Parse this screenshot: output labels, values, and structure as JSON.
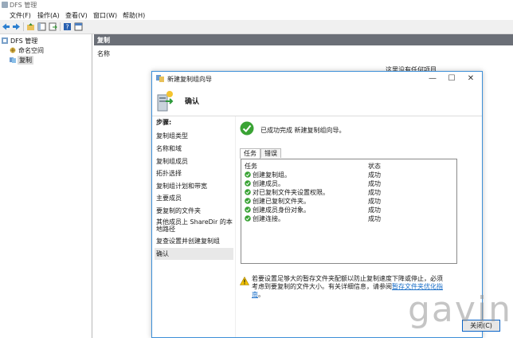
{
  "window": {
    "title": "DFS 管理"
  },
  "menu": [
    "文件(F)",
    "操作(A)",
    "查看(V)",
    "窗口(W)",
    "帮助(H)"
  ],
  "tree": [
    {
      "label": "DFS 管理"
    },
    {
      "label": "命名空间"
    },
    {
      "label": "复制"
    }
  ],
  "main": {
    "header": "复制",
    "column": "名称",
    "bg_text": "这里没有任何项目"
  },
  "wizard": {
    "title": "新建复制组向导",
    "header": "确认",
    "steps_header": "步骤:",
    "steps": [
      "复制组类型",
      "名称和域",
      "复制组成员",
      "拓扑选择",
      "复制组计划和带宽",
      "主要成员",
      "要复制的文件夹",
      "其他成员上 ShareDir 的本地路径",
      "复查设置并创建复制组",
      "确认"
    ],
    "success_text": "已成功完成 新建复制组向导。",
    "tabs": [
      "任务",
      "错误"
    ],
    "columns": {
      "task": "任务",
      "status": "状态"
    },
    "tasks": [
      {
        "name": "创建复制组。",
        "status": "成功"
      },
      {
        "name": "创建成员。",
        "status": "成功"
      },
      {
        "name": "对已复制文件夹设置权限。",
        "status": "成功"
      },
      {
        "name": "创建已复制文件夹。",
        "status": "成功"
      },
      {
        "name": "创建成员身份对象。",
        "status": "成功"
      },
      {
        "name": "创建连接。",
        "status": "成功"
      }
    ],
    "note_prefix": "若要设置足够大的暂存文件夹配额以防止复制速度下降或停止，必须考虑到要复制的文件大小。有关详细信息，请参阅",
    "note_link": "暂存文件夹优化指南",
    "note_suffix": "。",
    "close_button": "关闭(C)"
  },
  "watermark": "gavin",
  "colors": {
    "accent": "#3d8fd8",
    "success": "#3aa335",
    "warning": "#e8b400",
    "header_bg": "#6b6f77"
  }
}
